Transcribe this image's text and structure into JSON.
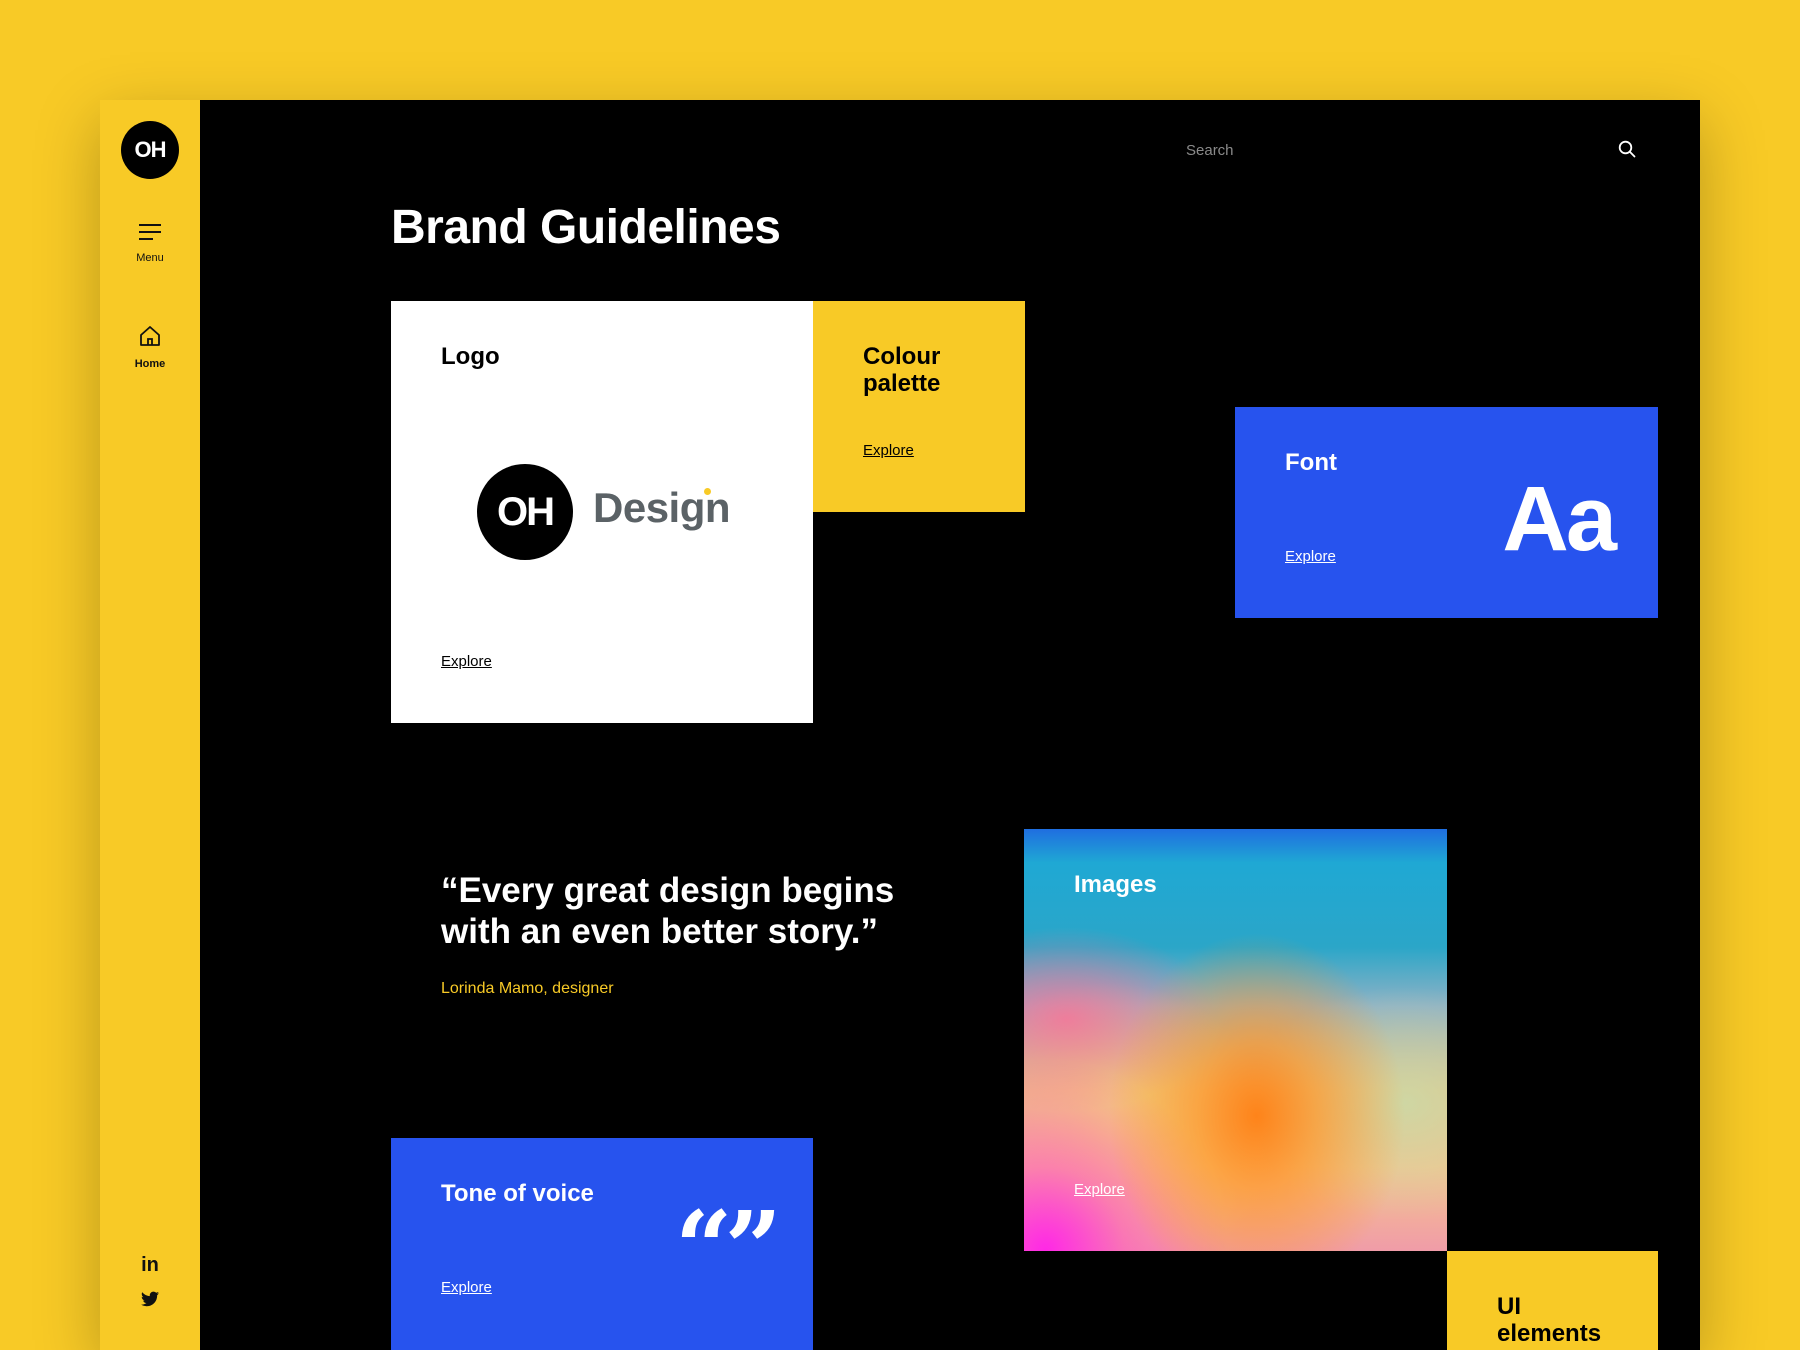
{
  "sidebar": {
    "badge": "OH",
    "menu_label": "Menu",
    "home_label": "Home",
    "social": {
      "linkedin": "in"
    }
  },
  "search": {
    "placeholder": "Search"
  },
  "page_title": "Brand Guidelines",
  "cards": {
    "logo": {
      "title": "Logo",
      "mark": "OH",
      "wordmark": "Design",
      "link": "Explore"
    },
    "colour": {
      "title": "Colour palette",
      "link": "Explore"
    },
    "font": {
      "title": "Font",
      "sample": "Aa",
      "link": "Explore"
    },
    "images": {
      "title": "Images",
      "link": "Explore"
    },
    "tone": {
      "title": "Tone of voice",
      "glyph": "“”",
      "link": "Explore"
    },
    "ui": {
      "title": "UI elements"
    }
  },
  "quote": {
    "text": "“Every great design begins with an even better story.”",
    "author": "Lorinda Mamo, designer"
  },
  "colors": {
    "accent_yellow": "#f8ca26",
    "accent_blue": "#2753ee",
    "background": "#000000"
  }
}
